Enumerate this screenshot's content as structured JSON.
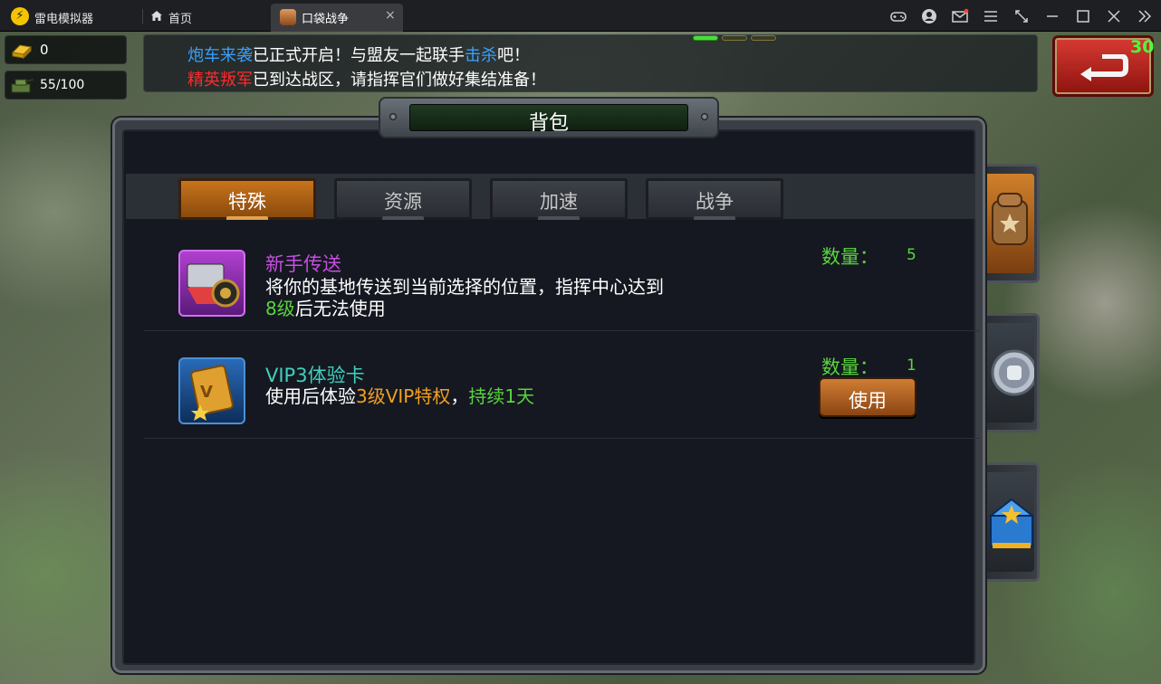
{
  "emulator": {
    "app_name": "雷电模拟器",
    "home_label": "首页",
    "tab_label": "口袋战争",
    "tab_close": "×",
    "icons": [
      "gamepad-icon",
      "user-icon",
      "mail-icon",
      "menu-icon",
      "shrink-icon",
      "minimize-icon",
      "maximize-icon",
      "close-icon",
      "collapse-icon"
    ]
  },
  "resources": {
    "gold": "0",
    "troops": "55/100"
  },
  "news": {
    "line1_hl1": "炮车来袭",
    "line1_a": "已正式开启！与盟友一起联手",
    "line1_hl2": "击杀",
    "line1_b": "吧！",
    "line2_hl": "精英叛军",
    "line2_a": "已到达战区，请指挥官们做好集结准备！"
  },
  "timer": "30",
  "panel": {
    "title": "背包",
    "tabs": [
      {
        "label": "特殊"
      },
      {
        "label": "资源"
      },
      {
        "label": "加速"
      },
      {
        "label": "战争"
      }
    ],
    "items": [
      {
        "name": "新手传送",
        "desc_a": "将你的基地传送到当前选择的位置，指挥中心达到",
        "desc_hl": "8级",
        "desc_b": "后无法使用",
        "qty_label": "数量：",
        "qty": "5"
      },
      {
        "name": "VIP3体验卡",
        "desc_a": "使用后体验",
        "desc_hl": "3级VIP特权",
        "desc_sep": "，",
        "desc_hl2": "持续1天",
        "qty_label": "数量：",
        "qty": "1",
        "use_label": "使用"
      }
    ]
  },
  "colors": {
    "accent_green": "#59d43f",
    "news_blue": "#39a0ff",
    "news_red": "#ff2a2a",
    "item1_name": "#c54fe0",
    "item2_name": "#3fd0c0",
    "highlight_orange": "#f0a020",
    "tab_active": "#c8741c"
  }
}
